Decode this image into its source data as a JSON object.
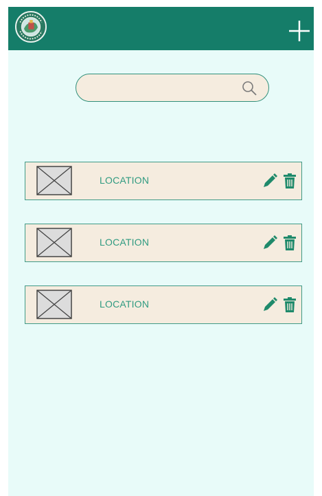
{
  "header": {
    "logo_icon": "todo-travel-logo-icon",
    "add_icon": "plus-icon",
    "background_color": "#157d69"
  },
  "search": {
    "placeholder": "",
    "value": "",
    "icon": "search-icon"
  },
  "locations": [
    {
      "label": "LOCATION",
      "image_icon": "image-placeholder-icon",
      "edit_icon": "pencil-icon",
      "delete_icon": "trash-icon"
    },
    {
      "label": "LOCATION",
      "image_icon": "image-placeholder-icon",
      "edit_icon": "pencil-icon",
      "delete_icon": "trash-icon"
    },
    {
      "label": "LOCATION",
      "image_icon": "image-placeholder-icon",
      "edit_icon": "pencil-icon",
      "delete_icon": "trash-icon"
    }
  ],
  "colors": {
    "accent": "#157d69",
    "card_background": "#f5ecdf",
    "page_background": "#e8fbf9",
    "label_text": "#2f9a80"
  }
}
